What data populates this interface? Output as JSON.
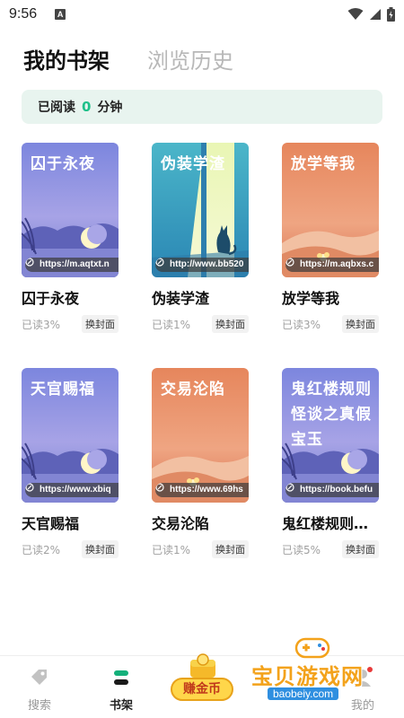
{
  "status_bar": {
    "time": "9:56",
    "notification_letter": "A"
  },
  "tabs": {
    "active": "我的书架",
    "inactive": "浏览历史"
  },
  "reading": {
    "prefix": "已阅读",
    "minutes": "0",
    "suffix": "分钟"
  },
  "swap_label": "换封面",
  "books": [
    {
      "title": "囚于永夜",
      "cover_title": "囚于永夜",
      "url": "https://m.aqtxt.n",
      "progress": "已读3%",
      "theme": "moon-purple"
    },
    {
      "title": "伪装学渣",
      "cover_title": "伪装学渣",
      "url": "http://www.bb520",
      "progress": "已读1%",
      "theme": "teal-cat"
    },
    {
      "title": "放学等我",
      "cover_title": "放学等我",
      "url": "https://m.aqbxs.c",
      "progress": "已读3%",
      "theme": "desert"
    },
    {
      "title": "天官赐福",
      "cover_title": "天官赐福",
      "url": "https://www.xbiq",
      "progress": "已读2%",
      "theme": "moon-purple"
    },
    {
      "title": "交易沦陷",
      "cover_title": "交易沦陷",
      "url": "https://www.69hs",
      "progress": "已读1%",
      "theme": "desert"
    },
    {
      "title": "鬼红楼规则…",
      "cover_title": "鬼红楼规则怪谈之真假宝玉",
      "url": "https://book.befu",
      "progress": "已读5%",
      "theme": "moon-purple"
    }
  ],
  "nav": {
    "search": "搜索",
    "shelf": "书架",
    "earn": "赚金币",
    "mine": "我的"
  },
  "watermark": {
    "title": "宝贝游戏网",
    "url": "baobeiy.com"
  },
  "colors": {
    "accent": "#1ec08a",
    "reading_bg": "#e8f4ef"
  }
}
